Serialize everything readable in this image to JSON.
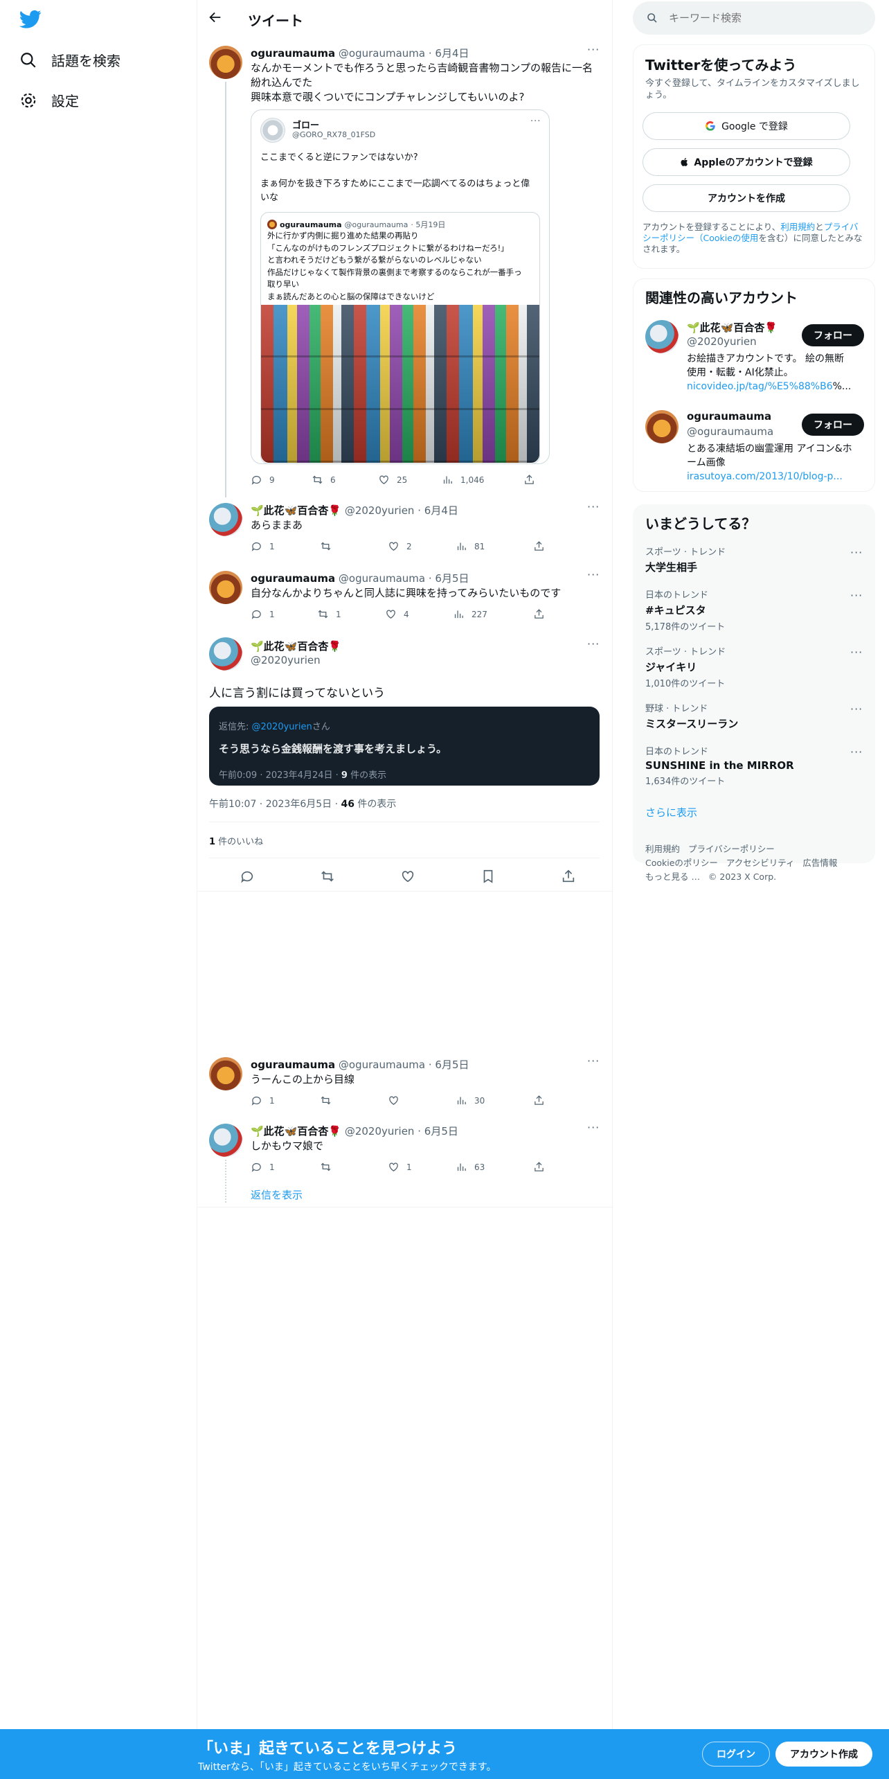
{
  "nav": {
    "search_label": "話題を検索",
    "settings_label": "設定"
  },
  "header": {
    "title": "ツイート"
  },
  "search": {
    "placeholder": "キーワード検索"
  },
  "tweet1": {
    "name": "oguraumauma",
    "handle": "@oguraumauma",
    "date": "· 6月4日",
    "text_line1": "なんかモーメントでも作ろうと思ったら吉崎観音書物コンプの報告に一名",
    "text_line2": "紛れ込んでた",
    "text_line3": "興味本意で覗くついでにコンプチャレンジしてもいいのよ?",
    "quote": {
      "name": "ゴロー",
      "handle": "@GORO_RX78_01FSD",
      "line1": "ここまでくると逆にファンではないか?",
      "line2": "まぁ何かを扱き下ろすためにここまで一応調べてるのはちょっと偉",
      "line3": "いな",
      "inner": {
        "name": "oguraumauma",
        "handle": "@oguraumauma",
        "date": "· 5月19日",
        "l1": "外に行かず内側に掘り進めた結果の再貼り",
        "l2": "「こんなのがけものフレンズプロジェクトに繋がるわけねーだろ!」",
        "l3": "と言われそうだけどもう繋がる繋がらないのレベルじゃない",
        "l4": "作品だけじゃなくて製作背景の裏側まで考察するのならこれが一番手っ",
        "l5": "取り早い",
        "l6": "まぁ読んだあとの心と脳の保障はできないけど"
      }
    },
    "replies": "9",
    "retweets": "6",
    "likes": "25",
    "views": "1,046"
  },
  "tweet2": {
    "name": "🌱此花🦋百合杏🌹",
    "handle": "@2020yurien",
    "date": "· 6月4日",
    "text": "あらままあ",
    "replies": "1",
    "retweets": "",
    "likes": "2",
    "views": "81"
  },
  "tweet3": {
    "name": "oguraumauma",
    "handle": "@oguraumauma",
    "date": "· 6月5日",
    "text": "自分なんかよりちゃんと同人誌に興味を持ってみらいたいものです",
    "replies": "1",
    "retweets": "1",
    "likes": "4",
    "views": "227"
  },
  "main_tweet": {
    "name": "🌱此花🦋百合杏🌹",
    "handle": "@2020yurien",
    "text": "人に言う割には買ってないという",
    "note_prefix": "返信先: ",
    "note_handle": "@2020yurien",
    "note_suffix": "さん",
    "note_text": "そう思うなら金銭報酬を渡す事を考えましょう。",
    "note_meta": "午前0:09 · 2023年4月24日 · ",
    "note_views_num": "9",
    "note_views_label": " 件の表示",
    "meta": "午前10:07 · 2023年6月5日 · ",
    "views_num": "46",
    "views_label": " 件の表示",
    "likes_num": "1",
    "likes_label": " 件のいいね"
  },
  "tweet4": {
    "name": "oguraumauma",
    "handle": "@oguraumauma",
    "date": "· 6月5日",
    "text": "うーんこの上から目線",
    "replies": "1",
    "retweets": "",
    "likes": "",
    "views": "30"
  },
  "tweet5": {
    "name": "🌱此花🦋百合杏🌹",
    "handle": "@2020yurien",
    "date": "· 6月5日",
    "text": "しかもウマ娘で",
    "replies": "1",
    "retweets": "",
    "likes": "1",
    "views": "63"
  },
  "show_replies": "返信を表示",
  "signup": {
    "title": "Twitterを使ってみよう",
    "subtitle": "今すぐ登録して、タイムラインをカスタマイズしましょう。",
    "google": "Google で登録",
    "apple": "Appleのアカウントで登録",
    "create": "アカウントを作成",
    "terms_1": "アカウントを登録することにより、",
    "terms_link1": "利用規約",
    "terms_2": "と",
    "terms_link2": "プライバシーポリシー（Cookieの使用",
    "terms_3": "を含む）に同意したとみなされます。"
  },
  "related": {
    "title": "関連性の高いアカウント",
    "follow_label": "フォロー",
    "accounts": [
      {
        "name": "🌱此花🦋百合杏🌹",
        "handle": "@2020yurien",
        "bio1": "お絵描きアカウントです。 絵の無断",
        "bio2": "使用・転載・AI化禁止。",
        "link": "nicovideo.jp/tag/%E5%88%B6",
        "link_suffix": "%..."
      },
      {
        "name": "oguraumauma",
        "handle": "@oguraumauma",
        "bio1": "とある凍結垢の幽霊運用 アイコン&ホ",
        "bio2": "ーム画像",
        "link": "irasutoya.com/2013/10/blog-p..."
      }
    ]
  },
  "trends": {
    "title": "いまどうしてる？",
    "items": [
      {
        "cat": "スポーツ · トレンド",
        "name": "大学生相手",
        "count": ""
      },
      {
        "cat": "日本のトレンド",
        "name": "#キュピスタ",
        "count": "5,178件のツイート"
      },
      {
        "cat": "スポーツ · トレンド",
        "name": "ジャイキリ",
        "count": "1,010件のツイート"
      },
      {
        "cat": "野球 · トレンド",
        "name": "ミスタースリーラン",
        "count": ""
      },
      {
        "cat": "日本のトレンド",
        "name": "SUNSHINE in the MIRROR",
        "count": "1,634件のツイート"
      }
    ],
    "more": "さらに表示"
  },
  "footer": {
    "l1a": "利用規約",
    "l1b": "プライバシーポリシー",
    "l2a": "Cookieのポリシー",
    "l2b": "アクセシビリティ",
    "l2c": "広告情報",
    "l3a": "もっと見る …",
    "l3b": "© 2023 X Corp."
  },
  "banner": {
    "title": "「いま」起きていることを見つけよう",
    "subtitle": "Twitterなら、「いま」起きていることをいち早くチェックできます。",
    "login": "ログイン",
    "signup": "アカウント作成"
  },
  "colors": {
    "accent": "#1d9bf0",
    "banner": "#1d9bf0",
    "text": "#0f1419",
    "muted": "#536471"
  }
}
